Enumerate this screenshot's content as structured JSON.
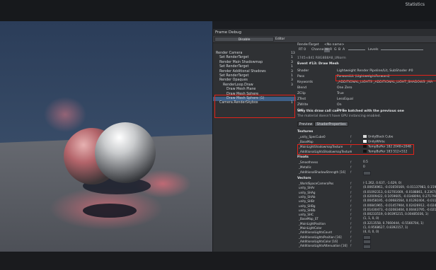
{
  "window": {
    "stats": "Statistics"
  },
  "frame_debug": {
    "title": "Frame Debug",
    "toolbar": {
      "disable": "Disable",
      "editor": "Editor"
    },
    "render_target": {
      "label": "RenderTarget",
      "value": "<No name>"
    },
    "channels": {
      "rt": "RT 0",
      "label": "Channels",
      "all": "All",
      "r": "R",
      "g": "G",
      "b": "B",
      "a": "A",
      "levels": "Levels"
    },
    "tree": [
      {
        "label": "Render Camera",
        "count": "13",
        "indent": 0,
        "selected": false
      },
      {
        "label": "Set RenderTarget",
        "count": "1",
        "indent": 1,
        "selected": false
      },
      {
        "label": "Render Main Shadowmap",
        "count": "3",
        "indent": 1,
        "selected": false
      },
      {
        "label": "Set RenderTarget",
        "count": "1",
        "indent": 1,
        "selected": false
      },
      {
        "label": "Render Additional Shadows",
        "count": "3",
        "indent": 1,
        "selected": false
      },
      {
        "label": "Set RenderTarget",
        "count": "1",
        "indent": 1,
        "selected": false
      },
      {
        "label": "Render Opaques",
        "count": "3",
        "indent": 1,
        "selected": false
      },
      {
        "label": "RenderLoop.Draw",
        "count": "3",
        "indent": 2,
        "selected": false
      },
      {
        "label": "Draw Mesh Plane",
        "count": "",
        "indent": 3,
        "selected": false
      },
      {
        "label": "Draw Mesh Sphere",
        "count": "",
        "indent": 3,
        "selected": false
      },
      {
        "label": "Draw Mesh Sphere (1)",
        "count": "",
        "indent": 3,
        "selected": true
      },
      {
        "label": "Camera.RenderSkybox",
        "count": "1",
        "indent": 1,
        "selected": false
      }
    ],
    "details": {
      "size_line": "1745×841 R8G8B8A8_UNorm",
      "event": "Event #13: Draw Mesh",
      "props": [
        {
          "k": "Shader",
          "v": "Lightweight Render Pipeline/Lit, SubShader #0"
        },
        {
          "k": "Pass",
          "v": "ForwardLit (LightweightForward)"
        },
        {
          "k": "Keywords",
          "v": "_ADDITIONAL_LIGHTS _ADDITIONAL_LIGHT_SHADOWS _MA"
        },
        {
          "k": "Blend",
          "v": "One Zero"
        },
        {
          "k": "ZClip",
          "v": "True"
        },
        {
          "k": "ZTest",
          "v": "LessEqual"
        },
        {
          "k": "ZWrite",
          "v": "On"
        },
        {
          "k": "Cull",
          "v": "Back"
        }
      ],
      "batch_title": "Why this draw call can't be batched with the previous one",
      "batch_reason": "The material doesn't have GPU instancing enabled.",
      "tabs": [
        "Preview",
        "ShaderProperties"
      ],
      "textures_header": "Textures",
      "textures": [
        {
          "name": "_unity_SpecCube0",
          "flag": "f",
          "value": "UnityBlack Cube",
          "swatch": "#d8d8d8"
        },
        {
          "name": "_BaseMap",
          "flag": "f",
          "value": "UnityWhite",
          "swatch": "#ffffff"
        },
        {
          "name": "_MainLightShadowmapTexture",
          "flag": "f",
          "value": "TempBuffer 182 2048×2048",
          "swatch": "#111111"
        },
        {
          "name": "_AdditionalLightsShadowmapTexture",
          "flag": "f",
          "value": "TempBuffer 183 512×512",
          "swatch": "#111111"
        }
      ],
      "floats_header": "Floats",
      "floats": [
        {
          "name": "_Smoothness",
          "flag": "f",
          "value": "0.5"
        },
        {
          "name": "_Metallic",
          "flag": "f",
          "value": "0"
        },
        {
          "name": "_AdditionalShadowStrength [16]",
          "flag": "f",
          "value": ""
        }
      ],
      "vectors_header": "Vectors",
      "vectors": [
        {
          "name": "_WorldSpaceCameraPos",
          "flag": "f",
          "value": "(-1.262, 0.637, -1.629, 0)"
        },
        {
          "name": "unity_SHAr",
          "flag": "f",
          "value": "(0.00656961, -0.01659169, -0.01137983, 0.1599)"
        },
        {
          "name": "unity_SHAg",
          "flag": "f",
          "value": "(0.01092313, 0.02701669, -0.0188861, 0.2367)"
        },
        {
          "name": "unity_SHAb",
          "flag": "f",
          "value": "(0.02009422, 0.1059605, -0.0348094, 0.2717980)"
        },
        {
          "name": "unity_SHBr",
          "flag": "f",
          "value": "(0.00458195, -0.00683564, 0.01292404, -0.0112)"
        },
        {
          "name": "unity_SHBg",
          "flag": "f",
          "value": "(0.00841965, -0.01457904, 0.02426912, -0.0247)"
        },
        {
          "name": "unity_SHBb",
          "flag": "f",
          "value": "(0.01430473, -0.02083404, 0.00443795, -0.0213)"
        },
        {
          "name": "unity_SHC",
          "flag": "f",
          "value": "(0.00233519, 0.00395215, 0.00485036, 1)"
        },
        {
          "name": "_BaseMap_ST",
          "flag": "f",
          "value": "(1, 1, 0, 0)"
        },
        {
          "name": "_MainLightPosition",
          "flag": "f",
          "value": "(0.3213558, 0.7660444, -0.5566704, 1)"
        },
        {
          "name": "_MainLightColor",
          "flag": "f",
          "value": "(1, 0.9568627, 0.8392157, 1)"
        },
        {
          "name": "_AdditionalLightsCount",
          "flag": "f",
          "value": "(4, 0, 0, 0)"
        },
        {
          "name": "_AdditionalLightsPosition [16]",
          "flag": "f",
          "value": ""
        },
        {
          "name": "_AdditionalLightsColor [16]",
          "flag": "f",
          "value": ""
        },
        {
          "name": "_AdditionalLightsAttenuation [16]",
          "flag": "f",
          "value": ""
        }
      ]
    }
  },
  "colors": {
    "highlight": "#e2231a",
    "selection": "#3e5f86"
  }
}
